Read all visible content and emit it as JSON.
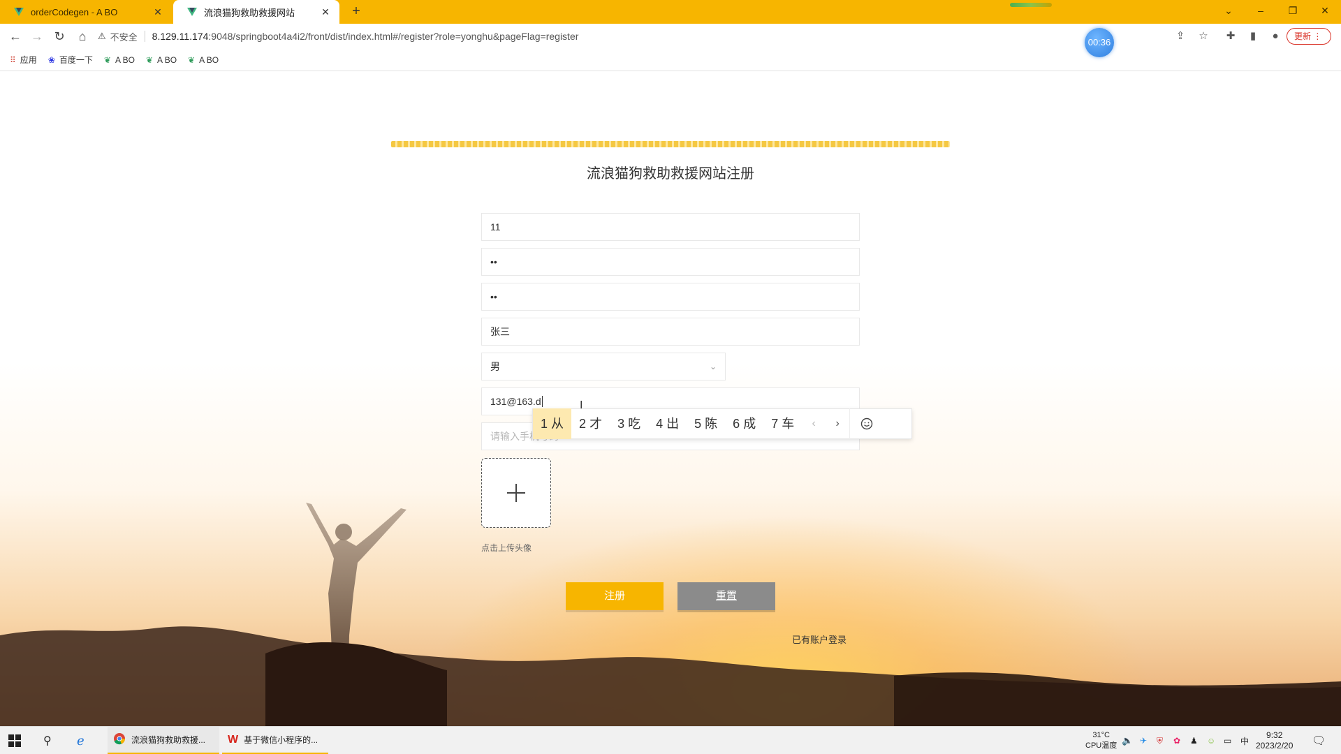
{
  "browser": {
    "tabs": [
      {
        "title": "orderCodegen - A BO",
        "active": false
      },
      {
        "title": "流浪猫狗救助救援网站",
        "active": true
      }
    ],
    "address": {
      "security_label": "不安全",
      "url_host": "8.129.11.174",
      "url_rest": ":9048/springboot4a4i2/front/dist/index.html#/register?role=yonghu&pageFlag=register"
    },
    "timer_badge": "00:36",
    "update_label": "更新",
    "bookmarks": [
      {
        "label": "应用",
        "icon": "apps-grid-icon"
      },
      {
        "label": "百度一下",
        "icon": "baidu-paw-icon"
      },
      {
        "label": "A BO",
        "icon": "leaf-icon"
      },
      {
        "label": "A BO",
        "icon": "leaf-icon"
      },
      {
        "label": "A BO",
        "icon": "leaf-icon"
      }
    ]
  },
  "register": {
    "title": "流浪猫狗救助救援网站注册",
    "fields": {
      "account": "11",
      "password": "••",
      "password_confirm": "••",
      "name": "张三",
      "gender": "男",
      "email": "131@163.d",
      "phone_placeholder": "请输入手机号码"
    },
    "upload_hint": "点击上传头像",
    "submit_label": "注册",
    "reset_label": "重置",
    "login_link": "已有账户登录"
  },
  "ime": {
    "candidates": [
      {
        "num": "1",
        "char": "从"
      },
      {
        "num": "2",
        "char": "才"
      },
      {
        "num": "3",
        "char": "吃"
      },
      {
        "num": "4",
        "char": "出"
      },
      {
        "num": "5",
        "char": "陈"
      },
      {
        "num": "6",
        "char": "成"
      },
      {
        "num": "7",
        "char": "车"
      }
    ],
    "selected_index": 0
  },
  "taskbar": {
    "apps": [
      {
        "label": "流浪猫狗救助救援...",
        "icon": "chrome-icon"
      },
      {
        "label": "基于微信小程序的...",
        "icon": "wps-icon"
      }
    ],
    "temperature": "31°C",
    "cpu_label": "CPU温度",
    "ime_lang": "中",
    "time": "9:32",
    "date": "2023/2/20"
  },
  "colors": {
    "brand": "#f7b500",
    "reset_button": "#8b8b8b",
    "ime_selected": "#fde9b0"
  }
}
